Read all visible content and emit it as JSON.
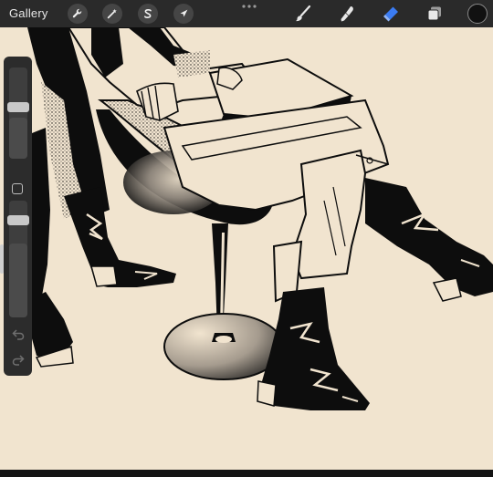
{
  "toolbar": {
    "gallery_label": "Gallery",
    "left_tools": [
      {
        "name": "actions",
        "icon": "wrench-icon"
      },
      {
        "name": "adjustments",
        "icon": "magic-wand-icon"
      },
      {
        "name": "selection",
        "icon": "selection-s-icon"
      },
      {
        "name": "transform",
        "icon": "arrow-cursor-icon"
      }
    ],
    "more_icon": "more-dots-icon",
    "right_tools": [
      {
        "name": "brush",
        "icon": "brush-icon",
        "active": false
      },
      {
        "name": "smudge",
        "icon": "smudge-finger-icon",
        "active": false
      },
      {
        "name": "eraser",
        "icon": "eraser-icon",
        "active": true
      },
      {
        "name": "layers",
        "icon": "layers-icon",
        "active": false
      }
    ],
    "active_color": "#111111",
    "accent_color": "#3b7cf3"
  },
  "sidebar": {
    "brush_size_level": 0.45,
    "opacity_level": 0.63,
    "modify_button_icon": "square-icon",
    "undo_icon": "undo-arrow-icon",
    "redo_icon": "redo-arrow-icon"
  },
  "canvas": {
    "paper_color": "#f1e4cf",
    "ink_color": "#0d0d0d",
    "artwork": "ink-illustration-seated-figures-boots-stool"
  }
}
